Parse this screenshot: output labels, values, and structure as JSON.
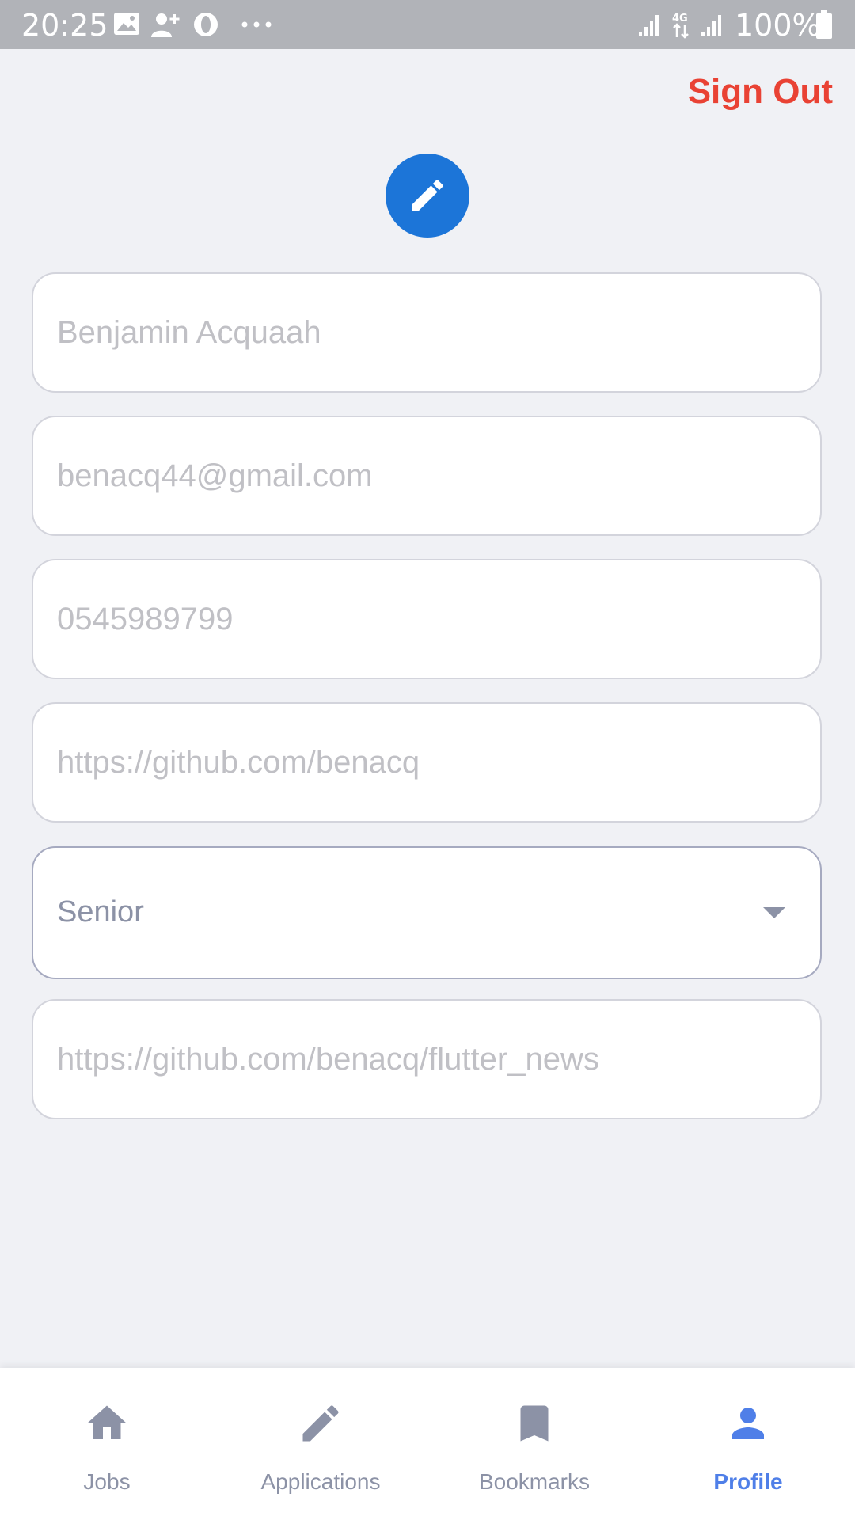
{
  "status_bar": {
    "time": "20:25",
    "battery": "100%",
    "network": "4G",
    "icons": [
      "image-icon",
      "add-contact-icon",
      "opera-icon",
      "more-dots-icon",
      "signal-icon",
      "signal-4g-icon",
      "signal-icon",
      "battery-icon"
    ]
  },
  "header": {
    "sign_out_label": "Sign Out"
  },
  "avatar": {
    "icon": "pencil-icon"
  },
  "form": {
    "name_placeholder": "Benjamin Acquaah",
    "email_placeholder": "benacq44@gmail.com",
    "phone_placeholder": "0545989799",
    "github_placeholder": "https://github.com/benacq",
    "level_value": "Senior",
    "project_placeholder": "https://github.com/benacq/flutter_news"
  },
  "nav": {
    "items": [
      {
        "label": "Jobs",
        "icon": "home-icon"
      },
      {
        "label": "Applications",
        "icon": "pencil-icon"
      },
      {
        "label": "Bookmarks",
        "icon": "bookmark-icon"
      },
      {
        "label": "Profile",
        "icon": "person-icon"
      }
    ],
    "active": "Profile"
  },
  "colors": {
    "accent": "#1C75D8",
    "sign_out": "#E94234",
    "nav_active": "#4F7FE8",
    "nav_inactive": "#8C92A6",
    "background": "#F0F1F5"
  }
}
